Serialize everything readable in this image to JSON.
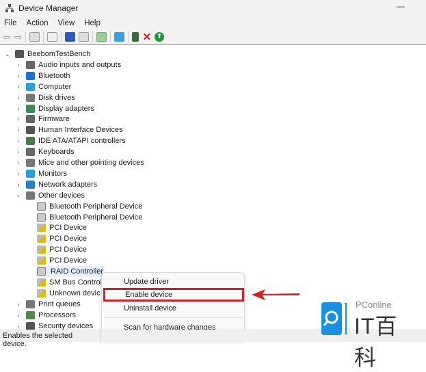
{
  "window": {
    "title": "Device Manager"
  },
  "menu": [
    "File",
    "Action",
    "View",
    "Help"
  ],
  "tree": {
    "root": "BeebomTestBench",
    "categories": [
      {
        "label": "Audio inputs and outputs",
        "color": "#666"
      },
      {
        "label": "Bluetooth",
        "color": "#1e73d2"
      },
      {
        "label": "Computer",
        "color": "#2aa0d8"
      },
      {
        "label": "Disk drives",
        "color": "#777"
      },
      {
        "label": "Display adapters",
        "color": "#3a8a5a"
      },
      {
        "label": "Firmware",
        "color": "#666"
      },
      {
        "label": "Human Interface Devices",
        "color": "#555"
      },
      {
        "label": "IDE ATA/ATAPI controllers",
        "color": "#4a7a4a"
      },
      {
        "label": "Keyboards",
        "color": "#666"
      },
      {
        "label": "Mice and other pointing devices",
        "color": "#777"
      },
      {
        "label": "Monitors",
        "color": "#2aa0d8"
      },
      {
        "label": "Network adapters",
        "color": "#2a80c8"
      },
      {
        "label": "Other devices",
        "color": "#777",
        "expanded": true
      }
    ],
    "other_devices": [
      "Bluetooth Peripheral Device",
      "Bluetooth Peripheral Device",
      "PCI Device",
      "PCI Device",
      "PCI Device",
      "PCI Device",
      "RAID Controller",
      "SM Bus Controll",
      "Unknown devic"
    ],
    "after": [
      "Print queues",
      "Processors",
      "Security devices"
    ]
  },
  "context_menu": {
    "items": [
      "Update driver",
      "Enable device",
      "Uninstall device",
      "Scan for hardware changes"
    ],
    "highlighted": "Enable device"
  },
  "status": "Enables the selected device.",
  "watermark": {
    "brand": "PConline",
    "sub": "IT百科"
  }
}
